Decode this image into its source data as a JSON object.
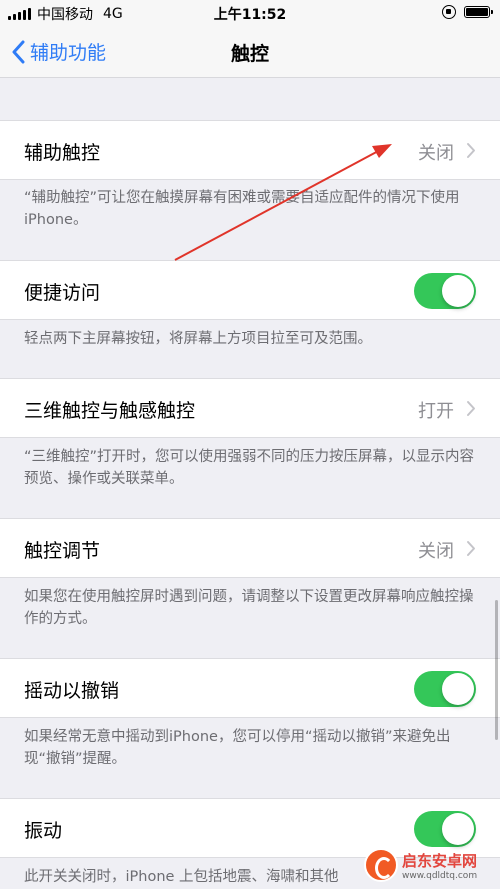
{
  "status_bar": {
    "carrier": "中国移动",
    "network": "4G",
    "time": "上午11:52"
  },
  "nav": {
    "back_label": "辅助功能",
    "title": "触控"
  },
  "rows": [
    {
      "label": "辅助触控",
      "value": "关闭",
      "type": "disclosure"
    },
    {
      "label": "便捷访问",
      "type": "switch",
      "on": true
    },
    {
      "label": "三维触控与触感触控",
      "value": "打开",
      "type": "disclosure"
    },
    {
      "label": "触控调节",
      "value": "关闭",
      "type": "disclosure"
    },
    {
      "label": "摇动以撤销",
      "type": "switch",
      "on": true
    },
    {
      "label": "振动",
      "type": "switch",
      "on": true
    }
  ],
  "footnotes": [
    "“辅助触控”可让您在触摸屏幕有困难或需要自适应配件的情况下使用 iPhone。",
    "轻点两下主屏幕按钮，将屏幕上方项目拉至可及范围。",
    "“三维触控”打开时，您可以使用强弱不同的压力按压屏幕，以显示内容预览、操作或关联菜单。",
    "如果您在使用触控屏时遇到问题，请调整以下设置更改屏幕响应触控操作的方式。",
    "如果经常无意中摇动到iPhone，您可以停用“摇动以撤销”来避免出现“撤销”提醒。",
    "此开关关闭时，iPhone 上包括地震、海啸和其他"
  ],
  "colors": {
    "accent": "#2f7cf6",
    "switch_on": "#34c759",
    "annotation_arrow": "#e0342a"
  },
  "watermark": {
    "name": "启东安卓网",
    "url": "www.qdldtq.com"
  }
}
